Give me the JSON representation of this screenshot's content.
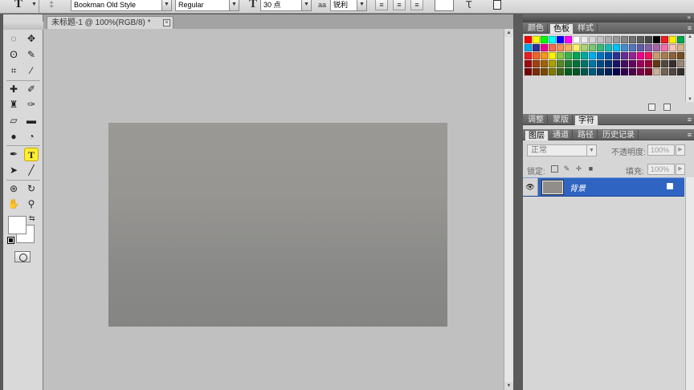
{
  "options_bar": {
    "tool_icon": "type-tool-icon",
    "font_family": "Bookman Old Style",
    "font_style": "Regular",
    "font_size": "30 点",
    "aa_icon": "aa",
    "antialias": "锐利"
  },
  "document": {
    "tab_title": "未标题-1 @ 100%(RGB/8) *",
    "close": "×"
  },
  "swatches_panel": {
    "tabs": [
      "颜色",
      "色板",
      "样式"
    ],
    "active_tab": 1,
    "menu_glyph": "≡",
    "colors": [
      "#ff0000",
      "#ffff00",
      "#00ff00",
      "#00ffff",
      "#0000ff",
      "#ff00ff",
      "#ffffff",
      "#ebebeb",
      "#d6d6d6",
      "#c2c2c2",
      "#adadad",
      "#999999",
      "#858585",
      "#707070",
      "#5c5c5c",
      "#474747",
      "#000000",
      "#ee1c24",
      "#fff200",
      "#00a651",
      "#00aeef",
      "#2e3192",
      "#ec008c",
      "#f26c4f",
      "#f68e56",
      "#fbaf5d",
      "#fff568",
      "#acd373",
      "#7cc576",
      "#3bb878",
      "#1abbb4",
      "#00bff3",
      "#438ccb",
      "#5574b9",
      "#605ca8",
      "#855fa8",
      "#a763a8",
      "#f06eaa",
      "#f2c3b3",
      "#d2b48c",
      "#ed1c24",
      "#f26522",
      "#f7941d",
      "#fff200",
      "#8dc63f",
      "#39b54a",
      "#00a651",
      "#00a99d",
      "#00aeef",
      "#0072bc",
      "#0054a6",
      "#2e3192",
      "#662d91",
      "#92278f",
      "#ec008c",
      "#ed145b",
      "#c69c6d",
      "#a67c52",
      "#8c6239",
      "#754c24",
      "#9e0b0f",
      "#a0410d",
      "#a36209",
      "#aba000",
      "#598527",
      "#1a7b30",
      "#007236",
      "#00746b",
      "#0076a3",
      "#004a80",
      "#003471",
      "#1b1464",
      "#440e62",
      "#630460",
      "#9e005d",
      "#9e0039",
      "#603913",
      "#534741",
      "#362f2d",
      "#998675",
      "#790000",
      "#7b2e00",
      "#7d4900",
      "#827b00",
      "#406618",
      "#005e20",
      "#005826",
      "#005952",
      "#005b7f",
      "#003663",
      "#002157",
      "#0d004c",
      "#32004b",
      "#4b0049",
      "#7b0046",
      "#7a0026",
      "#c7b299",
      "#736357",
      "#534741",
      "#362f2d"
    ],
    "footer_icons": [
      "new-swatch-icon",
      "trash-icon"
    ]
  },
  "adjust_panel": {
    "tabs": [
      "调整",
      "蒙版",
      "字符"
    ],
    "active_tab": 2
  },
  "layers_panel": {
    "tabs": [
      "图层",
      "通道",
      "路径",
      "历史记录"
    ],
    "active_tab": 0,
    "blend_mode": "正常",
    "opacity_label": "不透明度:",
    "opacity_value": "100%",
    "lock_label": "锁定:",
    "fill_label": "填充:",
    "fill_value": "100%",
    "layers": [
      {
        "name": "背景",
        "visible": true,
        "locked": true
      }
    ]
  },
  "tools": {
    "active_tool": "type-tool"
  }
}
